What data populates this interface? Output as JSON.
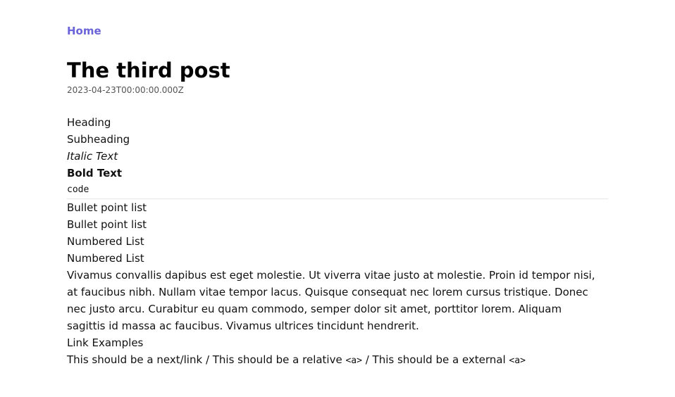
{
  "nav": {
    "home_label": "Home"
  },
  "post": {
    "title": "The third post",
    "date": "2023-04-23T00:00:00.000Z",
    "lines": {
      "heading": "Heading",
      "subheading": "Subheading",
      "italic": "Italic Text",
      "bold": "Bold Text",
      "code": "code",
      "bullet_1": "Bullet point list",
      "bullet_2": "Bullet point list",
      "numbered_1": "Numbered List",
      "numbered_2": "Numbered List",
      "paragraph": "Vivamus convallis dapibus est eget molestie. Ut viverra vitae justo at molestie. Proin id tempor nisi, at faucibus nibh. Nullam vitae tempor lacus. Quisque consequat nec lorem cursus tristique. Donec nec justo arcu. Curabitur eu quam commodo, semper dolor sit amet, porttitor lorem. Aliquam sagittis id massa ac faucibus. Vivamus ultrices tincidunt hendrerit.",
      "link_examples": "Link Examples"
    },
    "links_line": {
      "part1": "This should be a next/link / This should be a relative ",
      "code1": "<a>",
      "part2": " / This should be a external ",
      "code2": "<a>"
    }
  },
  "colors": {
    "link": "#6b63d8",
    "text": "#111111",
    "muted": "#555555",
    "divider": "#e6e6e6"
  }
}
